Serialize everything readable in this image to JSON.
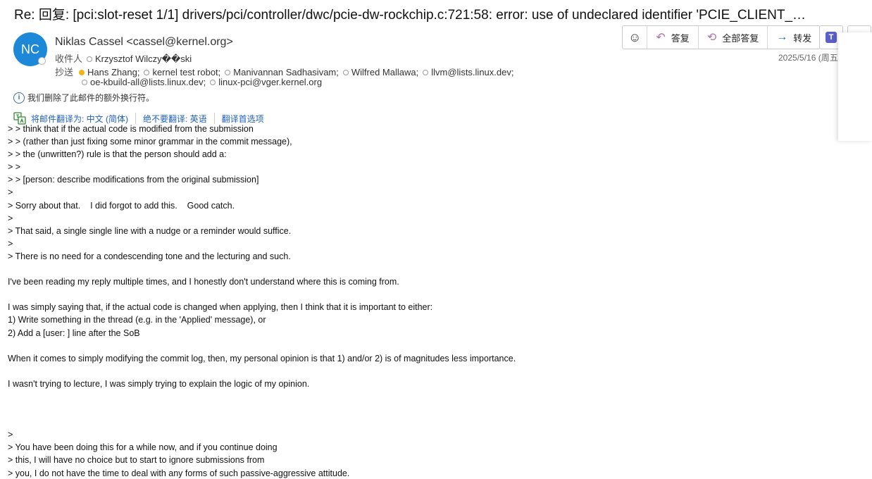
{
  "subject": "Re: 回复: [pci:slot-reset 1/1] drivers/pci/controller/dwc/pcie-dw-rockchip.c:721:58: error: use of undeclared identifier 'PCIE_CLIENT_…",
  "sender": {
    "initials": "NC",
    "name": "Niklas Cassel <cassel@kernel.org>"
  },
  "to": {
    "label": "收件人",
    "recipients": [
      "Krzysztof Wilczy��ski"
    ]
  },
  "cc": {
    "label": "抄送",
    "line1": [
      "Hans Zhang;",
      "kernel test robot;",
      "Manivannan Sadhasivam;",
      "Wilfred Mallawa;",
      "llvm@lists.linux.dev;"
    ],
    "line2": [
      "oe-kbuild-all@lists.linux.dev;",
      "linux-pci@vger.kernel.org"
    ]
  },
  "date": "2025/5/16 (周五",
  "notice": "我们删除了此邮件的额外换行符。",
  "translate": {
    "translate_to": "将邮件翻译为: 中文 (简体)",
    "never_translate": "绝不要翻译: 英语",
    "preferences": "翻译首选项"
  },
  "toolbar": {
    "reply": "答复",
    "reply_all": "全部答复",
    "forward": "转发"
  },
  "body_lines": [
    "> > think that if the actual code is modified from the submission",
    "> > (rather than just fixing some minor grammar in the commit message),",
    "> > the (unwritten?) rule is that the person should add a:",
    "> >",
    "> > [person: describe modifications from the original submission]",
    ">",
    "> Sorry about that.    I did forgot to add this.    Good catch.",
    ">",
    "> That said, a single single line with a nudge or a reminder would suffice.",
    ">",
    "> There is no need for a condescending tone and the lecturing and such.",
    "",
    "I've been reading my reply multiple times, and I honestly don't understand where this is coming from.",
    "",
    "I was simply saying that, if the actual code is changed when applying, then I think that it is important to either:",
    "1) Write something in the thread (e.g. in the 'Applied' message), or",
    "2) Add a [user: ] line after the SoB",
    "",
    "When it comes to simply modifying the commit log, then, my personal opinion is that 1) and/or 2) is of magnitudes less importance.",
    "",
    "I wasn't trying to lecture, I was simply trying to explain the logic of my opinion.",
    "",
    "",
    "",
    ">",
    "> You have been doing this for a while now, and if you continue doing",
    "> this, I will have no choice but to start to ignore submissions from",
    "> you, I do not have the time to deal with any forms of such passive-aggressive attitude."
  ]
}
